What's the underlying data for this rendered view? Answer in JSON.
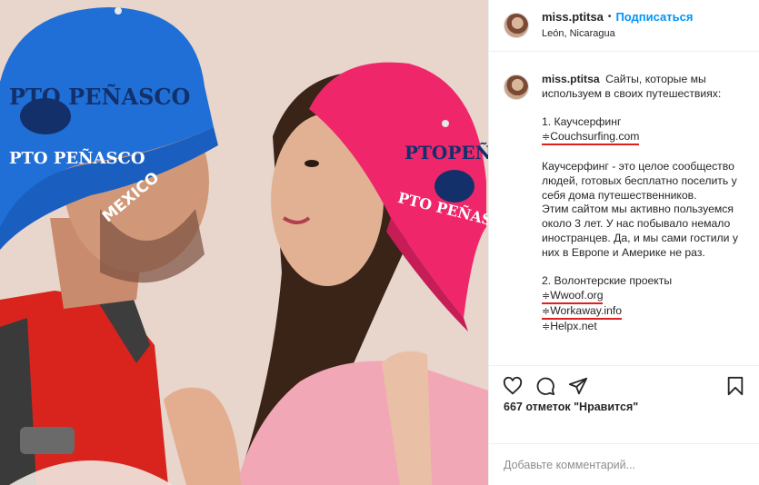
{
  "header": {
    "username": "miss.ptitsa",
    "separator": "•",
    "follow_label": "Подписаться",
    "location": "León, Nicaragua"
  },
  "caption": {
    "username": "miss.ptitsa",
    "intro": "Сайты, которые мы используем в своих путешествиях:",
    "item1_title": "1. Каучсерфинг",
    "item1_arrow": "≑",
    "item1_link": "Couchsurfing.com",
    "item1_desc": "Каучсерфинг - это целое сообщество людей, готовых бесплатно поселить у себя дома путешественников.",
    "item1_desc2": "Этим сайтом мы активно пользуемся около 3 лет. У нас побывало немало иностранцев. Да, и мы сами гостили у них в Европе и Америке не раз.",
    "item2_title": "2. Волонтерские проекты",
    "item2_links": [
      {
        "arrow": "≑",
        "text": "Wwoof.org"
      },
      {
        "arrow": "≑",
        "text": "Workaway.info"
      },
      {
        "arrow": "≑",
        "text": "Helpx.net"
      }
    ]
  },
  "actions": {
    "like_icon": "heart-icon",
    "comment_icon": "comment-icon",
    "share_icon": "share-icon",
    "save_icon": "bookmark-icon"
  },
  "likes_text": "667 отметок \"Нравится\"",
  "comment_placeholder": "Добавьте комментарий...",
  "photo": {
    "cap1_line1": "PTO PEÑASCO",
    "cap1_line2": "PTO PEÑASCO",
    "cap1_brim": "MEXICO",
    "cap2_line1": "PTOPEÑ",
    "cap2_line2": "PTO PEÑAS",
    "colors": {
      "blue_cap": "#1f6fd6",
      "pink_cap": "#f0266b",
      "red_shirt": "#d8241c",
      "pink_top": "#f2a7b6",
      "wall": "#e9d6cc"
    }
  }
}
